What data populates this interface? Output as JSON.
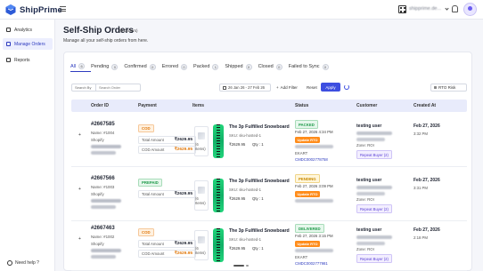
{
  "app": {
    "name": "ShipPrime",
    "account": "shipprime.de..."
  },
  "sidebar": {
    "items": [
      {
        "label": "Analytics"
      },
      {
        "label": "Manage Orders"
      },
      {
        "label": "Reports"
      }
    ],
    "help_label": "Need help ?"
  },
  "header": {
    "title": "Self-Ship Orders",
    "count": "(6 Orders)",
    "subtitle": "Manage all your self-ship orders from here."
  },
  "tabs": [
    {
      "label": "All",
      "count": "6"
    },
    {
      "label": "Pending",
      "count": "0"
    },
    {
      "label": "Confirmed",
      "count": "0"
    },
    {
      "label": "Errored",
      "count": "0"
    },
    {
      "label": "Packed",
      "count": "1"
    },
    {
      "label": "Shipped",
      "count": "0"
    },
    {
      "label": "Closed",
      "count": "0"
    },
    {
      "label": "Failed to Sync",
      "count": "0"
    }
  ],
  "filters": {
    "search_type": "Search By",
    "search_placeholder": "Search Order",
    "date_range": "26 Jan 26 - 27 Feb 26",
    "add_filter": "Add Filter",
    "reset": "Reset",
    "apply": "Apply",
    "risk_select": "RTO Risk"
  },
  "table": {
    "columns": [
      "Order ID",
      "Payment",
      "Items",
      "Status",
      "Customer",
      "Created At"
    ],
    "rows": [
      {
        "order_id": "#2667585",
        "name": "Name: #1004",
        "store": "Shopify",
        "payment_type": "COD",
        "total_label": "Total Amount",
        "total": "₹2629.95",
        "cod_label": "COD Amount",
        "cod": "₹2629.95",
        "item_count": "(6 Items)",
        "product": "The 3p Fulfilled Snowboard",
        "sku": "SKU: sku-hosted-1",
        "price": "₹2629.95",
        "qty": "Qty : 1",
        "status": "PACKED",
        "status_date": "Feb 27, 2026 4:34 PM",
        "update_badge": "Update RTO",
        "courier": "EKART",
        "awb": "CMDC0002778758",
        "customer": "testing user",
        "zone": "Zone: ROI",
        "tag": "Repeat Buyer (2)",
        "created_date": "Feb 27, 2026",
        "created_time": "3:32 PM"
      },
      {
        "order_id": "#2667566",
        "name": "Name: #1003",
        "store": "Shopify",
        "payment_type": "PREPAID",
        "total_label": "Total Amount",
        "total": "₹2629.95",
        "item_count": "(6 Items)",
        "product": "The 3p Fulfilled Snowboard",
        "sku": "SKU: sku-hosted-1",
        "price": "₹2629.95",
        "qty": "Qty : 1",
        "status": "PENDING",
        "status_date": "Feb 27, 2026 3:09 PM",
        "update_badge": "Update RTO",
        "customer": "testing user",
        "zone": "Zone: ROI",
        "tag": "Repeat Buyer (2)",
        "created_date": "Feb 27, 2026",
        "created_time": "3:31 PM"
      },
      {
        "order_id": "#2667463",
        "name": "Name: #1002",
        "store": "Shopify",
        "payment_type": "COD",
        "total_label": "Total Amount",
        "total": "₹2629.95",
        "cod_label": "COD Amount",
        "cod": "₹2629.95",
        "item_count": "(6 Items)",
        "product": "The 3p Fulfilled Snowboard",
        "sku": "SKU: sku-hosted-1",
        "price": "₹2629.95",
        "qty": "Qty : 1",
        "status": "DELIVERED",
        "status_date": "Feb 27, 2026 3:15 PM",
        "update_badge": "Update RTO",
        "courier": "EKART",
        "awb": "CMDC0002777981",
        "customer": "testing user",
        "zone": "Zone: ROI",
        "tag": "Repeat Buyer (2)",
        "created_date": "Feb 27, 2026",
        "created_time": "2:18 PM"
      }
    ]
  }
}
